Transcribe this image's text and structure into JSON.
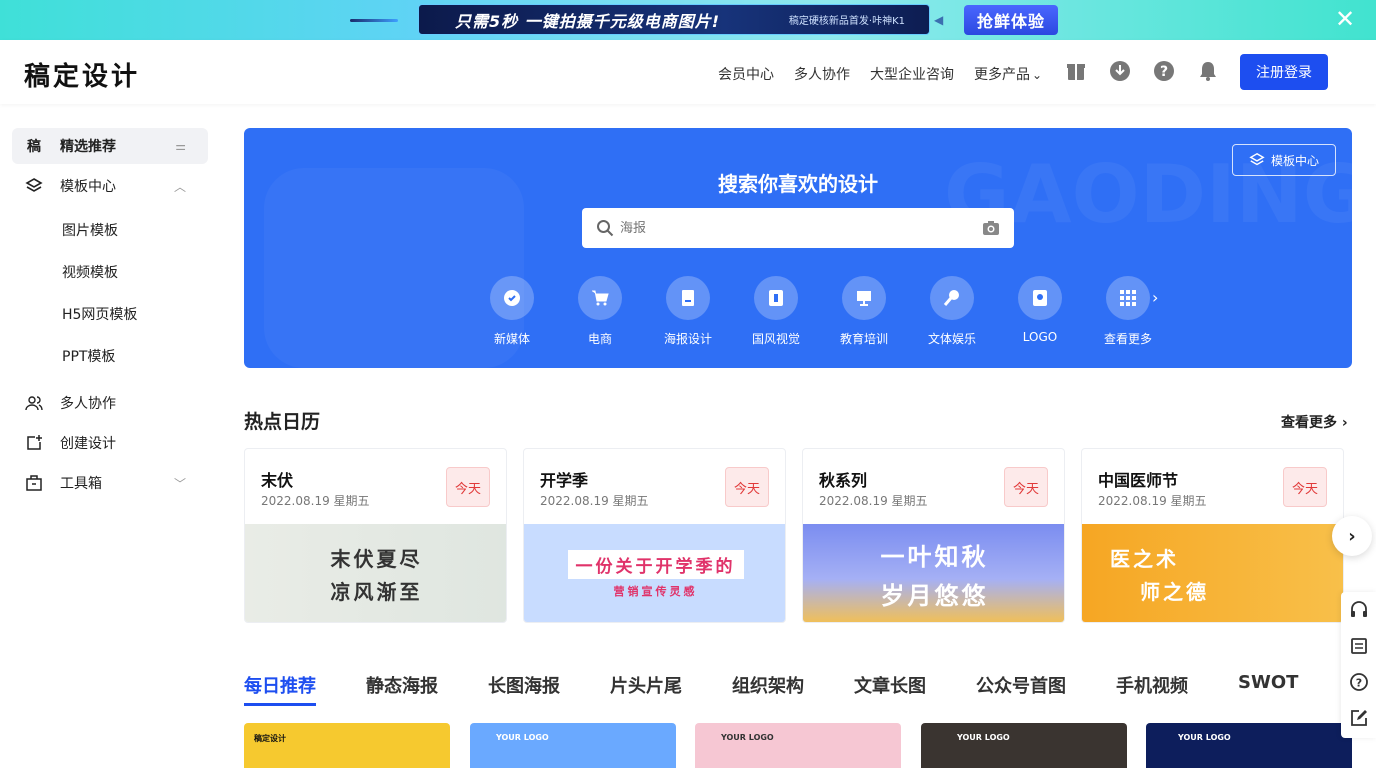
{
  "banner": {
    "headline": "只需5秒 一键拍摄千元级电商图片!",
    "sub": "稿定硬核新品首发·咔神K1",
    "try_label": "抢鲜体验",
    "close_glyph": "✕"
  },
  "header": {
    "logo": "稿定设计",
    "nav": [
      "会员中心",
      "多人协作",
      "大型企业咨询",
      "更多产品"
    ],
    "login_label": "注册登录"
  },
  "sidebar": {
    "featured": {
      "glyph": "稿",
      "label": "精选推荐"
    },
    "template_center": "模板中心",
    "template_subs": [
      "图片模板",
      "视频模板",
      "H5网页模板",
      "PPT模板"
    ],
    "collab": "多人协作",
    "create": "创建设计",
    "toolbox": "工具箱"
  },
  "hero": {
    "title": "搜索你喜欢的设计",
    "search_placeholder": "海报",
    "template_center_btn": "模板中心",
    "bg_text": "GAODING",
    "categories": [
      "新媒体",
      "电商",
      "海报设计",
      "国风视觉",
      "教育培训",
      "文体娱乐",
      "LOGO",
      "查看更多"
    ]
  },
  "hot": {
    "title": "热点日历",
    "see_more": "查看更多",
    "cards": [
      {
        "name": "末伏",
        "date": "2022.08.19  星期五",
        "badge": "今天",
        "img_line1": "末伏夏尽",
        "img_line2": "凉风渐至"
      },
      {
        "name": "开学季",
        "date": "2022.08.19  星期五",
        "badge": "今天",
        "img_line1": "一份关于开学季的",
        "img_line2": "营销宣传灵感"
      },
      {
        "name": "秋系列",
        "date": "2022.08.19  星期五",
        "badge": "今天",
        "img_line1": "一叶知秋",
        "img_line2": "岁月悠悠"
      },
      {
        "name": "中国医师节",
        "date": "2022.08.19  星期五",
        "badge": "今天",
        "img_line1": "医之术",
        "img_line2": "师之德"
      }
    ]
  },
  "tabs": [
    "每日推荐",
    "静态海报",
    "长图海报",
    "片头片尾",
    "组织架构",
    "文章长图",
    "公众号首图",
    "手机视频",
    "SWOT"
  ],
  "thumbs": [
    {
      "logo": "稿定设计"
    },
    {
      "logo": "YOUR LOGO"
    },
    {
      "logo": "YOUR LOGO"
    },
    {
      "logo": "YOUR LOGO"
    },
    {
      "logo": "YOUR LOGO"
    }
  ],
  "colors": {
    "accent": "#1d4ef0",
    "hero_bg": "#2f6ff5",
    "today_red": "#e13a3a"
  }
}
